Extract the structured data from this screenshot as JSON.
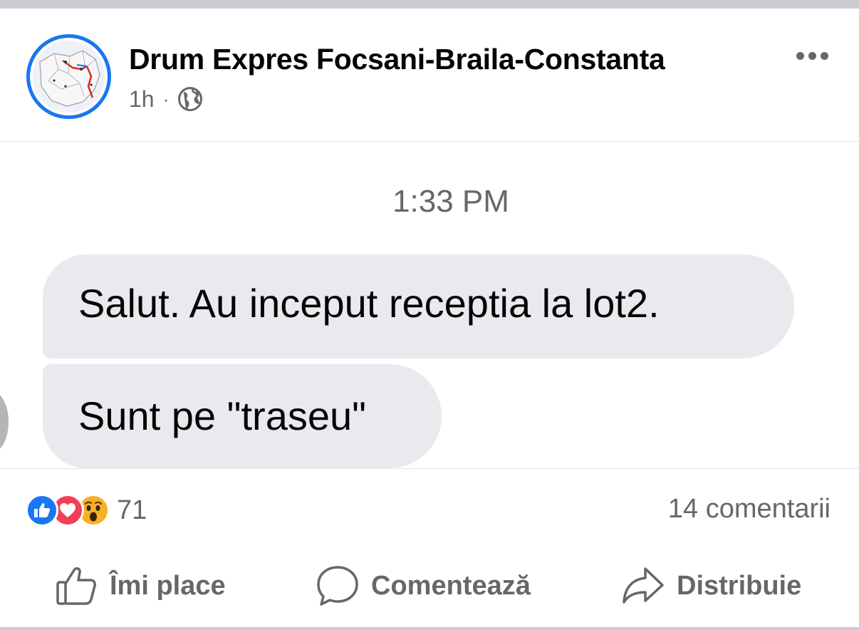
{
  "post": {
    "page_name": "Drum Expres Focsani-Braila-Constanta",
    "time_ago": "1h",
    "separator": "·",
    "audience_icon": "globe-icon",
    "more_icon": "more-options-icon"
  },
  "screenshot_content": {
    "timestamp": "1:33 PM",
    "messages": [
      "Salut. Au inceput receptia la lot2.",
      "Sunt pe \"traseu\""
    ]
  },
  "engagement": {
    "reaction_icons": [
      "like-reaction-icon",
      "love-reaction-icon",
      "wow-reaction-icon"
    ],
    "reaction_count": "71",
    "comments": "14 comentarii"
  },
  "actions": {
    "like": "Îmi place",
    "comment": "Comentează",
    "share": "Distribuie"
  },
  "colors": {
    "accent": "#1877f2",
    "love": "#f33e58",
    "wow": "#f7b125",
    "secondary_text": "#65676b",
    "bubble": "#e9eaee"
  }
}
